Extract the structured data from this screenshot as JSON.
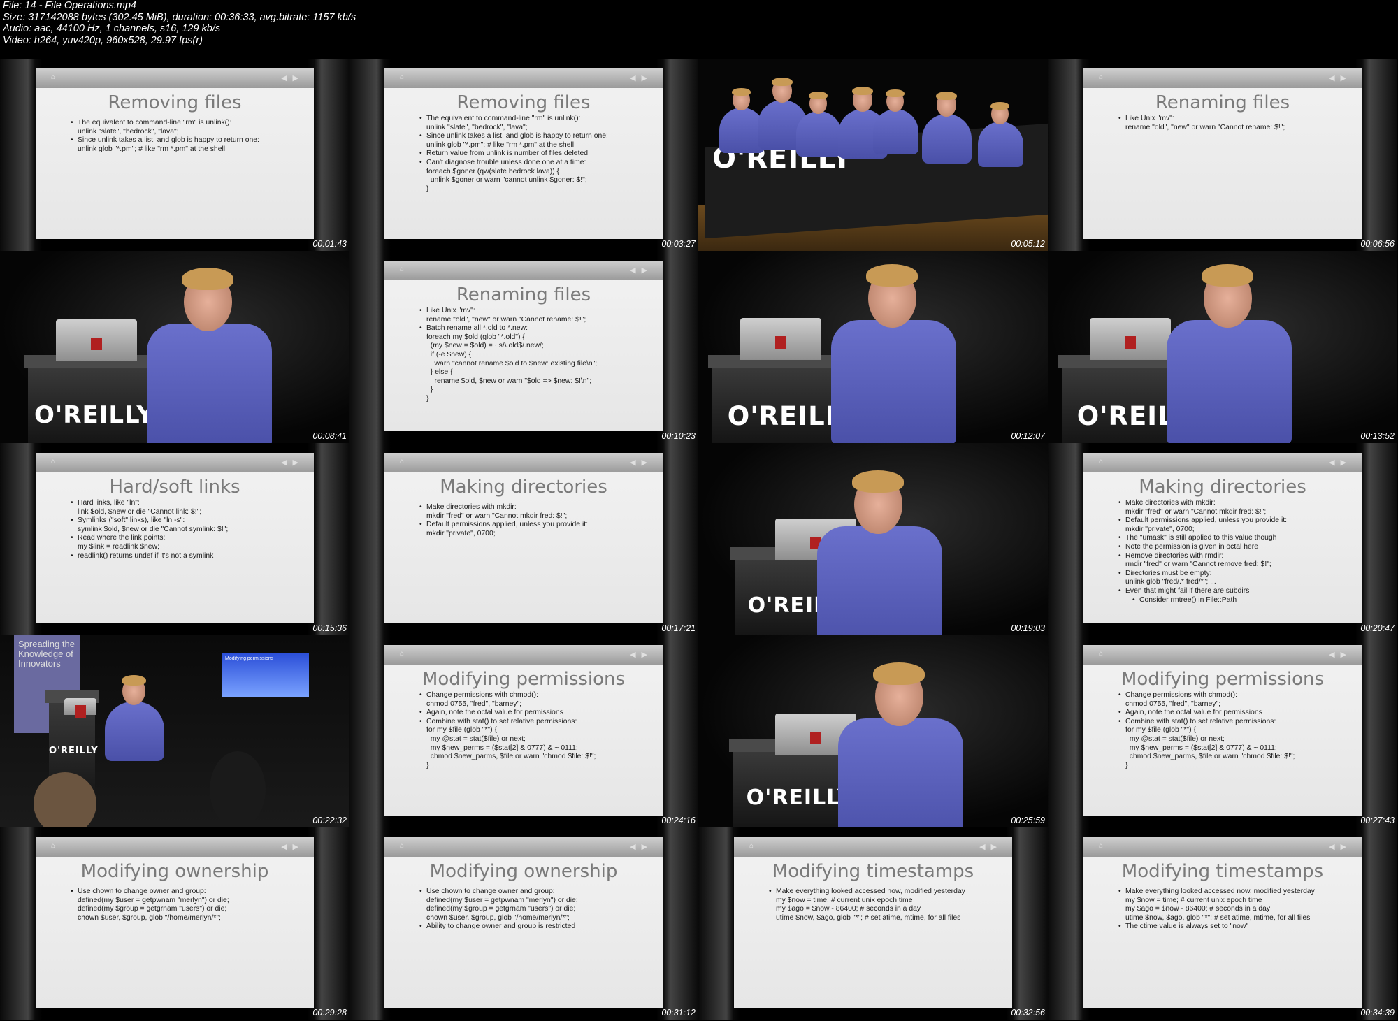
{
  "header": {
    "line1": "File: 14 - File Operations.mp4",
    "line2": "Size: 317142088 bytes (302.45 MiB), duration: 00:36:33, avg.bitrate: 1157 kb/s",
    "line3": "Audio: aac, 44100 Hz, 1 channels, s16, 129 kb/s",
    "line4": "Video: h264, yuv420p, 960x528, 29.97 fps(r)"
  },
  "logo_text": "O'REILLY",
  "banner_text": "Spreading the Knowledge of Innovators",
  "screen_text": "Modifying permissions",
  "tiles": [
    {
      "timestamp": "00:01:43",
      "title": "Removing files",
      "lines": [
        {
          "b": true,
          "t": "The equivalent to command-line \"rm\" is unlink():"
        },
        {
          "b": false,
          "t": "unlink \"slate\", \"bedrock\", \"lava\";"
        },
        {
          "b": true,
          "t": "Since unlink takes a list, and glob is happy to return one:"
        },
        {
          "b": false,
          "t": "unlink glob \"*.pm\"; # like \"rm *.pm\" at the shell"
        }
      ]
    },
    {
      "timestamp": "00:03:27",
      "title": "Removing files",
      "lines": [
        {
          "b": true,
          "t": "The equivalent to command-line \"rm\" is unlink():"
        },
        {
          "b": false,
          "t": "unlink \"slate\", \"bedrock\", \"lava\";"
        },
        {
          "b": true,
          "t": "Since unlink takes a list, and glob is happy to return one:"
        },
        {
          "b": false,
          "t": "unlink glob \"*.pm\"; # like \"rm *.pm\" at the shell"
        },
        {
          "b": true,
          "t": "Return value from unlink is number of files deleted"
        },
        {
          "b": true,
          "t": "Can't diagnose trouble unless done one at a time:"
        },
        {
          "b": false,
          "t": "foreach $goner (qw(slate bedrock lava)) {"
        },
        {
          "b": false,
          "t": "  unlink $goner or warn \"cannot unlink $goner: $!\";"
        },
        {
          "b": false,
          "t": "}"
        }
      ]
    },
    {
      "timestamp": "00:05:12"
    },
    {
      "timestamp": "00:06:56",
      "title": "Renaming files",
      "lines": [
        {
          "b": true,
          "t": "Like Unix \"mv\":"
        },
        {
          "b": false,
          "t": "rename \"old\", \"new\" or warn \"Cannot rename: $!\";"
        }
      ]
    },
    {
      "timestamp": "00:08:41"
    },
    {
      "timestamp": "00:10:23",
      "title": "Renaming files",
      "lines": [
        {
          "b": true,
          "t": "Like Unix \"mv\":"
        },
        {
          "b": false,
          "t": "rename \"old\", \"new\" or warn \"Cannot rename: $!\";"
        },
        {
          "b": true,
          "t": "Batch rename all *.old to *.new:"
        },
        {
          "b": false,
          "t": "foreach my $old (glob \"*.old\") {"
        },
        {
          "b": false,
          "t": "  (my $new = $old) =~ s/\\.old$/.new/;"
        },
        {
          "b": false,
          "t": "  if (-e $new) {"
        },
        {
          "b": false,
          "t": "    warn \"cannot rename $old to $new: existing file\\n\";"
        },
        {
          "b": false,
          "t": "  } else {"
        },
        {
          "b": false,
          "t": "    rename $old, $new or warn \"$old => $new: $!\\n\";"
        },
        {
          "b": false,
          "t": "  }"
        },
        {
          "b": false,
          "t": "}"
        }
      ]
    },
    {
      "timestamp": "00:12:07"
    },
    {
      "timestamp": "00:13:52"
    },
    {
      "timestamp": "00:15:36",
      "title": "Hard/soft links",
      "lines": [
        {
          "b": true,
          "t": "Hard links, like \"ln\":"
        },
        {
          "b": false,
          "t": "link $old, $new or die \"Cannot link: $!\";"
        },
        {
          "b": true,
          "t": "Symlinks (\"soft\" links), like \"ln -s\":"
        },
        {
          "b": false,
          "t": "symlink $old, $new or die \"Cannot symlink: $!\";"
        },
        {
          "b": true,
          "t": "Read where the link points:"
        },
        {
          "b": false,
          "t": "my $link = readlink $new;"
        },
        {
          "b": true,
          "t": "readlink() returns undef if it's not a symlink"
        }
      ]
    },
    {
      "timestamp": "00:17:21",
      "title": "Making directories",
      "lines": [
        {
          "b": true,
          "t": "Make directories with mkdir:"
        },
        {
          "b": false,
          "t": "mkdir \"fred\" or warn \"Cannot mkdir fred: $!\";"
        },
        {
          "b": true,
          "t": "Default permissions applied, unless you provide it:"
        },
        {
          "b": false,
          "t": "mkdir \"private\", 0700;"
        }
      ]
    },
    {
      "timestamp": "00:19:03"
    },
    {
      "timestamp": "00:20:47",
      "title": "Making directories",
      "lines": [
        {
          "b": true,
          "t": "Make directories with mkdir:"
        },
        {
          "b": false,
          "t": "mkdir \"fred\" or warn \"Cannot mkdir fred: $!\";"
        },
        {
          "b": true,
          "t": "Default permissions applied, unless you provide it:"
        },
        {
          "b": false,
          "t": "mkdir \"private\", 0700;"
        },
        {
          "b": true,
          "t": "The \"umask\" is still applied to this value though"
        },
        {
          "b": true,
          "t": "Note the permission is given in octal here"
        },
        {
          "b": true,
          "t": "Remove directories with rmdir:"
        },
        {
          "b": false,
          "t": "rmdir \"fred\" or warn \"Cannot remove fred: $!\";"
        },
        {
          "b": true,
          "t": "Directories must be empty:"
        },
        {
          "b": false,
          "t": "unlink glob \"fred/.* fred/*\"; ..."
        },
        {
          "b": true,
          "t": "Even that might fail if there are subdirs"
        },
        {
          "b": true,
          "sub": true,
          "t": "Consider rmtree() in File::Path"
        }
      ]
    },
    {
      "timestamp": "00:22:32"
    },
    {
      "timestamp": "00:24:16",
      "title": "Modifying permissions",
      "lines": [
        {
          "b": true,
          "t": "Change permissions with chmod():"
        },
        {
          "b": false,
          "t": "chmod 0755, \"fred\", \"barney\";"
        },
        {
          "b": true,
          "t": "Again, note the octal value for permissions"
        },
        {
          "b": true,
          "t": "Combine with stat() to set relative permissions:"
        },
        {
          "b": false,
          "t": "for my $file (glob \"*\") {"
        },
        {
          "b": false,
          "t": "  my @stat = stat($file) or next;"
        },
        {
          "b": false,
          "t": "  my $new_perms = ($stat[2] & 0777) & ~ 0111;"
        },
        {
          "b": false,
          "t": "  chmod $new_parms, $file or warn \"chmod $file: $!\";"
        },
        {
          "b": false,
          "t": "}"
        }
      ]
    },
    {
      "timestamp": "00:25:59"
    },
    {
      "timestamp": "00:27:43",
      "title": "Modifying permissions",
      "lines": [
        {
          "b": true,
          "t": "Change permissions with chmod():"
        },
        {
          "b": false,
          "t": "chmod 0755, \"fred\", \"barney\";"
        },
        {
          "b": true,
          "t": "Again, note the octal value for permissions"
        },
        {
          "b": true,
          "t": "Combine with stat() to set relative permissions:"
        },
        {
          "b": false,
          "t": "for my $file (glob \"*\") {"
        },
        {
          "b": false,
          "t": "  my @stat = stat($file) or next;"
        },
        {
          "b": false,
          "t": "  my $new_perms = ($stat[2] & 0777) & ~ 0111;"
        },
        {
          "b": false,
          "t": "  chmod $new_parms, $file or warn \"chmod $file: $!\";"
        },
        {
          "b": false,
          "t": "}"
        }
      ]
    },
    {
      "timestamp": "00:29:28",
      "title": "Modifying ownership",
      "lines": [
        {
          "b": true,
          "t": "Use chown to change owner and group:"
        },
        {
          "b": false,
          "t": "defined(my $user = getpwnam \"merlyn\") or die;"
        },
        {
          "b": false,
          "t": "defined(my $group = getgrnam \"users\") or die;"
        },
        {
          "b": false,
          "t": "chown $user, $group, glob \"/home/merlyn/*\";"
        }
      ]
    },
    {
      "timestamp": "00:31:12",
      "title": "Modifying ownership",
      "lines": [
        {
          "b": true,
          "t": "Use chown to change owner and group:"
        },
        {
          "b": false,
          "t": "defined(my $user = getpwnam \"merlyn\") or die;"
        },
        {
          "b": false,
          "t": "defined(my $group = getgrnam \"users\") or die;"
        },
        {
          "b": false,
          "t": "chown $user, $group, glob \"/home/merlyn/*\";"
        },
        {
          "b": true,
          "t": "Ability to change owner and group is restricted"
        }
      ]
    },
    {
      "timestamp": "00:32:56",
      "title": "Modifying timestamps",
      "lines": [
        {
          "b": true,
          "t": "Make everything looked accessed now, modified yesterday"
        },
        {
          "b": false,
          "t": "my $now = time; # current unix epoch time"
        },
        {
          "b": false,
          "t": "my $ago = $now - 86400; # seconds in a day"
        },
        {
          "b": false,
          "t": "utime $now, $ago, glob \"*\"; # set atime, mtime, for all files"
        }
      ]
    },
    {
      "timestamp": "00:34:39",
      "title": "Modifying timestamps",
      "lines": [
        {
          "b": true,
          "t": "Make everything looked accessed now, modified yesterday"
        },
        {
          "b": false,
          "t": "my $now = time; # current unix epoch time"
        },
        {
          "b": false,
          "t": "my $ago = $now - 86400; # seconds in a day"
        },
        {
          "b": false,
          "t": "utime $now, $ago, glob \"*\"; # set atime, mtime, for all files"
        },
        {
          "b": true,
          "t": "The ctime value is always set to \"now\""
        }
      ]
    }
  ]
}
